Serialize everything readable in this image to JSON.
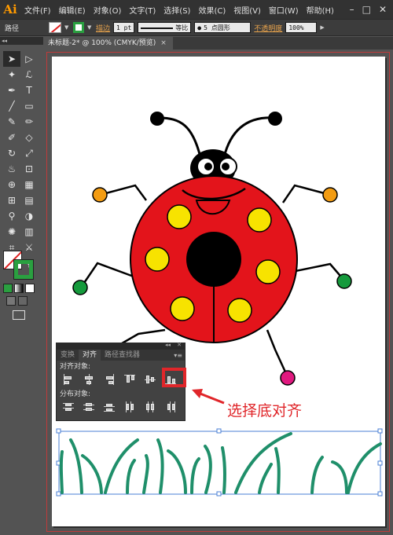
{
  "app": {
    "logo": "Ai",
    "menu": [
      "文件(F)",
      "编辑(E)",
      "对象(O)",
      "文字(T)",
      "选择(S)",
      "效果(C)",
      "视图(V)",
      "窗口(W)",
      "帮助(H)"
    ],
    "window_controls": [
      "–",
      "□",
      "✕"
    ]
  },
  "control_bar": {
    "selection_label": "路径",
    "stroke_label": "描边",
    "stroke_weight": "1 pt",
    "profile_label": "等比",
    "brush_label": "5 点圆形",
    "opacity_label": "不透明度",
    "opacity_value": "100%"
  },
  "document": {
    "tab_title": "未标题-2* @ 100% (CMYK/预览)",
    "tab_close": "×"
  },
  "colors": {
    "ladybug_red": "#e3141b",
    "spot_yellow": "#f7e300",
    "foot_orange": "#f39c12",
    "foot_green": "#159a3c",
    "foot_magenta": "#e0197f",
    "grass_teal": "#1f8f6a",
    "highlight_red": "#e0262a",
    "stroke_green": "#2aa040"
  },
  "tools": [
    "selection-icon",
    "direct-selection-icon",
    "magic-wand-icon",
    "lasso-icon",
    "pen-icon",
    "type-icon",
    "line-icon",
    "rectangle-icon",
    "paintbrush-icon",
    "pencil-icon",
    "blob-brush-icon",
    "eraser-icon",
    "rotate-icon",
    "scale-icon",
    "warp-icon",
    "free-transform-icon",
    "shape-builder-icon",
    "perspective-icon",
    "mesh-icon",
    "gradient-icon",
    "eyedropper-icon",
    "blend-icon",
    "symbol-sprayer-icon",
    "column-graph-icon",
    "artboard-icon",
    "slice-icon",
    "hand-icon",
    "zoom-icon"
  ],
  "align_panel": {
    "tabs": [
      "变换",
      "对齐",
      "路径查找器"
    ],
    "active_tab": "对齐",
    "align_objects_label": "对齐对象:",
    "distribute_objects_label": "分布对象:",
    "align_buttons": [
      "align-left-icon",
      "align-horizontal-center-icon",
      "align-right-icon",
      "align-top-icon",
      "align-vertical-center-icon",
      "align-bottom-icon"
    ],
    "distribute_buttons": [
      "distribute-top-icon",
      "distribute-vertical-center-icon",
      "distribute-bottom-icon",
      "distribute-left-icon",
      "distribute-horizontal-center-icon",
      "distribute-right-icon"
    ],
    "highlighted_button": "align-bottom-icon"
  },
  "annotation": {
    "text": "选择底对齐"
  }
}
